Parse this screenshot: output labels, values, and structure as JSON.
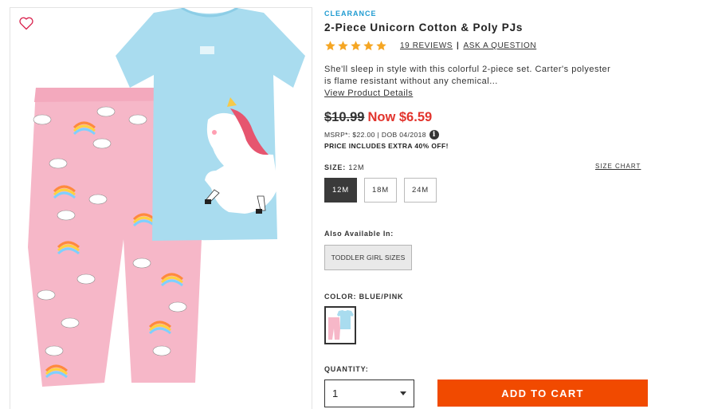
{
  "product": {
    "badge": "CLEARANCE",
    "title": "2-Piece Unicorn Cotton & Poly PJs",
    "rating": {
      "stars": 5,
      "max": 5,
      "reviews_label": "19 REVIEWS",
      "separator": "|",
      "ask_label": "ASK A QUESTION"
    },
    "description": "She'll sleep in style with this colorful 2-piece set. Carter's polyester is flame resistant without any chemical...",
    "details_link": "View Product Details",
    "pricing": {
      "original": "$10.99",
      "now": "Now $6.59",
      "msrp_line": "MSRP*: $22.00 | DOB 04/2018",
      "extra_off": "PRICE INCLUDES EXTRA 40% OFF!"
    },
    "size": {
      "label": "SIZE:",
      "selected": "12M",
      "chart_link": "SIZE CHART",
      "options": [
        "12M",
        "18M",
        "24M"
      ]
    },
    "also_available": {
      "label": "Also Available In:",
      "option": "TODDLER GIRL SIZES"
    },
    "color": {
      "label": "COLOR:",
      "selected": "BLUE/PINK"
    },
    "quantity": {
      "label": "QUANTITY:",
      "value": "1"
    },
    "add_to_cart": "ADD TO CART"
  },
  "colors": {
    "accent_blue": "#1f9bd1",
    "sale_red": "#e2342d",
    "star_orange": "#f5a623",
    "cta_orange": "#f14a00",
    "selected_dark": "#3a3a3a",
    "heart_red": "#d9224d",
    "shirt_blue": "#a9dcef",
    "pants_pink": "#f6b7c8"
  },
  "icons": {
    "wishlist": "heart-outline-icon",
    "rating": "star-icon",
    "info": "info-icon",
    "dropdown": "chevron-down-icon"
  }
}
